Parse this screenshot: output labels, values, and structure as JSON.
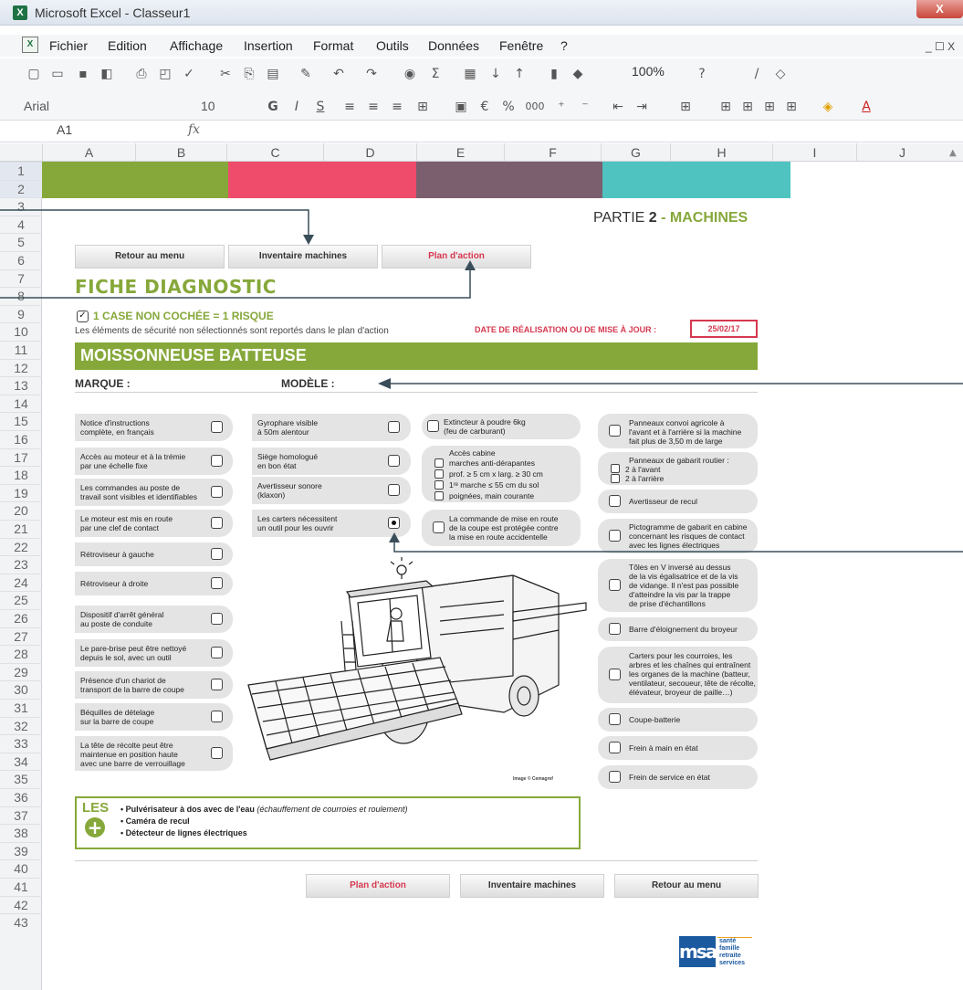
{
  "window": {
    "title": "Microsoft Excel - Classeur1",
    "close": "X",
    "icon": "X",
    "controls": "_ ☐ X"
  },
  "menu": {
    "items": [
      "Fichier",
      "Edition",
      "Affichage",
      "Insertion",
      "Format",
      "Outils",
      "Données",
      "Fenêtre",
      "?"
    ]
  },
  "toolbar": {
    "zoom": "100%",
    "font": "Arial",
    "size": "10",
    "bold": "G",
    "italic": "I",
    "underline": "S",
    "euro": "€",
    "percent": "%",
    "thousands": "000"
  },
  "formula": {
    "namebox": "A1",
    "fx": "fx"
  },
  "columns": [
    "A",
    "B",
    "C",
    "D",
    "E",
    "F",
    "G",
    "H",
    "I",
    "J"
  ],
  "rows": [
    "1",
    "2",
    "3",
    "4",
    "5",
    "6",
    "7",
    "8",
    "9",
    "10",
    "11",
    "12",
    "13",
    "14",
    "15",
    "16",
    "17",
    "18",
    "19",
    "20",
    "21",
    "22",
    "23",
    "24",
    "25",
    "26",
    "27",
    "28",
    "29",
    "30",
    "31",
    "32",
    "33",
    "34",
    "35",
    "36",
    "37",
    "38",
    "39",
    "40",
    "41",
    "42",
    "43"
  ],
  "colors": {
    "green": "#86a83a",
    "pink": "#ef4b6b",
    "mauve": "#7c5f6e",
    "teal": "#4fc3c0",
    "red": "#d6384f"
  },
  "header": {
    "partie_pre": "PARTIE ",
    "partie_num": "2",
    "partie_post": " - MACHINES",
    "nav": [
      "Retour au menu",
      "Inventaire machines",
      "Plan d'action"
    ],
    "fiche": "FICHE DIAGNOSTIC",
    "case_check": "✓",
    "case_rule": "1 CASE NON COCHÉE = 1 RISQUE",
    "sub": "Les éléments de sécurité non sélectionnés sont reportés dans le plan d'action",
    "date_label": "DATE DE RÉALISATION OU DE MISE À JOUR :",
    "date_value": "25/02/17",
    "title": "MOISSONNEUSE BATTEUSE",
    "marque": "MARQUE :",
    "modele": "MODÈLE :"
  },
  "col1": [
    "Notice d'instructions\ncomplète, en français",
    "Accès au moteur et à la trémie\npar une échelle fixe",
    "Les commandes au poste de\ntravail sont visibles et identifiables",
    "Le moteur est mis en route\npar une clef de contact",
    "Rétroviseur à gauche",
    "Rétroviseur à droite",
    "Dispositif d'arrêt général\nau poste de conduite",
    "Le pare-brise peut être nettoyé\ndepuis le sol, avec un outil",
    "Présence d'un chariot de\ntransport de la barre de coupe",
    "Béquilles de dételage\nsur la barre de coupe",
    "La tête de récolte peut être\nmaintenue en position haute\navec une barre de verrouillage"
  ],
  "col2": [
    "Gyrophare visible\nà 50m alentour",
    "Siège homologué\nen bon état",
    "Avertisseur sonore\n(klaxon)",
    "Les carters nécessitent\nun outil pour les ouvrir"
  ],
  "col3": {
    "extincteur": "Extincteur à poudre 6kg\n(feu de carburant)",
    "cabine_title": "Accès cabine",
    "cabine_lines": [
      "marches anti-dérapantes",
      "prof. ≥ 5 cm x larg. ≥ 30 cm",
      "1ʳᵉ marche ≤ 55 cm du sol",
      "poignées, main courante"
    ],
    "commande": "La commande de mise en route\nde la coupe est protégée contre\nla mise en route accidentelle"
  },
  "col4": {
    "panneaux_convoi": "Panneaux convoi agricole à\nl'avant et à l'arrière si la machine\nfait plus de 3,50 m de large",
    "gabarit_title": "Panneaux de gabarit routier :",
    "gabarit_lines": [
      "2 à l'avant",
      "2 à l'arrière"
    ],
    "items": [
      "Avertisseur de recul",
      "Pictogramme de gabarit en cabine\nconcernant les risques de contact\navec les lignes électriques",
      "Tôles en V inversé au dessus\nde la vis égalisatrice et de la vis\nde vidange. Il n'est pas possible\nd'atteindre la vis par la trappe\nde prise d'échantillons",
      "Barre d'éloignement du broyeur",
      "Carters pour les courroies, les\narbres et les chaînes qui entraînent\nles organes de la machine (batteur,\nventilateur, secoueur, tête de récolte,\nélévateur, broyeur de paille…)",
      "Coupe-batterie",
      "Frein à main en état",
      "Frein de service en état"
    ]
  },
  "image_credit": "Image © Cemagref",
  "les": {
    "title": "LES",
    "plus": "+",
    "line1_b": "• Pulvérisateur à dos avec de l'eau ",
    "line1_i": "(échauffement de courroies et roulement)",
    "line2": "• Caméra de recul",
    "line3": "• Détecteur de lignes électriques"
  },
  "bottom_nav": [
    "Plan d'action",
    "Inventaire machines",
    "Retour au menu"
  ],
  "logo": {
    "mark": "msa",
    "lines": [
      "santé",
      "famille",
      "retraite",
      "services"
    ]
  }
}
